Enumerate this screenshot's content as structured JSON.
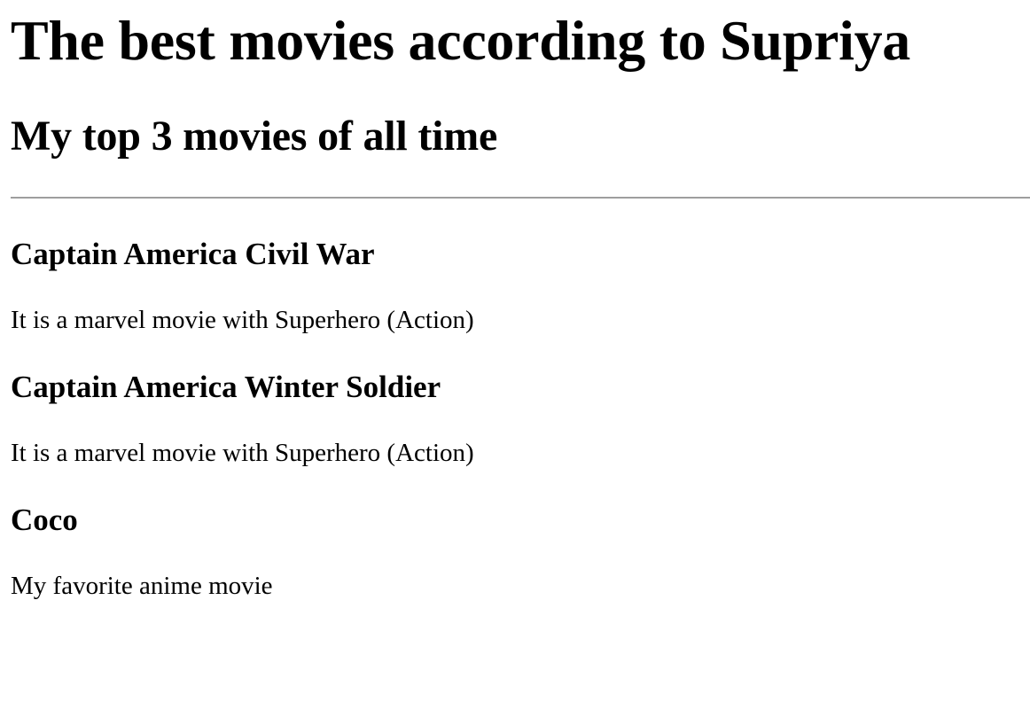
{
  "page": {
    "title": "The best movies according to Supriya",
    "subtitle": "My top 3 movies of all time"
  },
  "movies": [
    {
      "title": "Captain America Civil War",
      "description": "It is a marvel movie with Superhero (Action)"
    },
    {
      "title": "Captain America Winter Soldier",
      "description": "It is a marvel movie with Superhero (Action)"
    },
    {
      "title": "Coco",
      "description": "My favorite anime movie"
    }
  ]
}
